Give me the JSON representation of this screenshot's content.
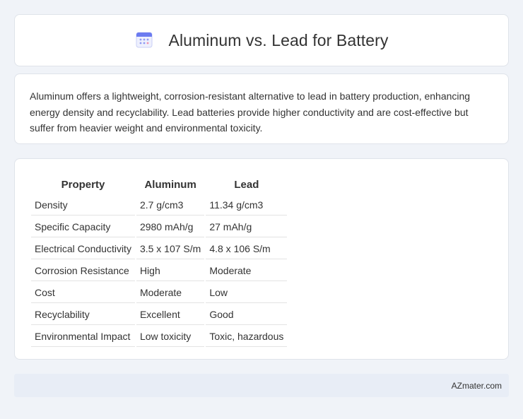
{
  "header": {
    "title": "Aluminum vs. Lead for Battery",
    "icon": "calendar-icon",
    "icon_color": "#6b7bf0"
  },
  "description": "Aluminum offers a lightweight, corrosion-resistant alternative to lead in battery production, enhancing energy density and recyclability. Lead batteries provide higher conductivity and are cost-effective but suffer from heavier weight and environmental toxicity.",
  "table": {
    "headers": [
      "Property",
      "Aluminum",
      "Lead"
    ],
    "rows": [
      [
        "Density",
        "2.7 g/cm3",
        "11.34 g/cm3"
      ],
      [
        "Specific Capacity",
        "2980 mAh/g",
        "27 mAh/g"
      ],
      [
        "Electrical Conductivity",
        "3.5 x 107 S/m",
        "4.8 x 106 S/m"
      ],
      [
        "Corrosion Resistance",
        "High",
        "Moderate"
      ],
      [
        "Cost",
        "Moderate",
        "Low"
      ],
      [
        "Recyclability",
        "Excellent",
        "Good"
      ],
      [
        "Environmental Impact",
        "Low toxicity",
        "Toxic, hazardous"
      ]
    ]
  },
  "footer": {
    "source": "AZmater.com"
  }
}
